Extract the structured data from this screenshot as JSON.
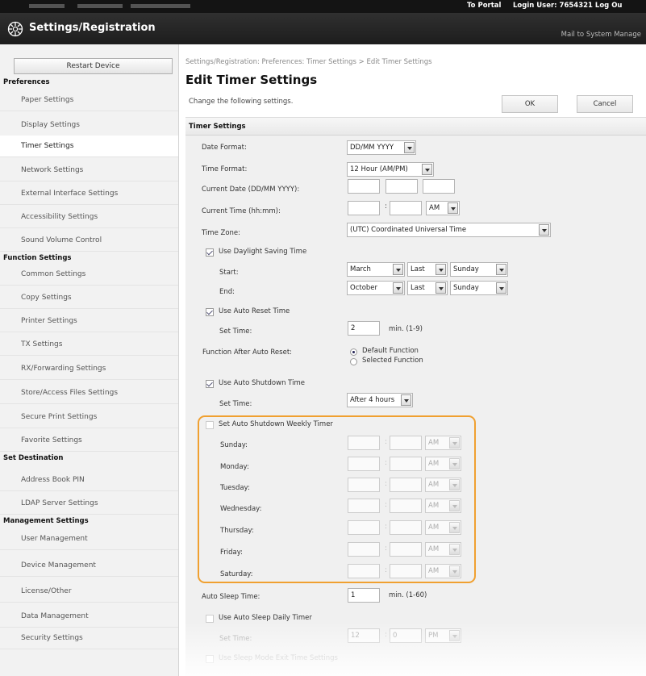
{
  "topbar": {
    "to_portal": "To Portal",
    "login_user": "Login User:  7654321  Log Ou"
  },
  "header": {
    "title": "Settings/Registration",
    "mail": "Mail to System Manage"
  },
  "sidebar": {
    "restart_label": "Restart Device",
    "sections": [
      {
        "title": "Preferences",
        "items": [
          "Paper Settings",
          "Display Settings",
          "Timer Settings",
          "Network Settings",
          "External Interface Settings",
          "Accessibility Settings",
          "Sound Volume Control"
        ]
      },
      {
        "title": "Function Settings",
        "items": [
          "Common Settings",
          "Copy Settings",
          "Printer Settings",
          "TX Settings",
          "RX/Forwarding Settings",
          "Store/Access Files Settings",
          "Secure Print Settings",
          "Favorite Settings"
        ]
      },
      {
        "title": "Set Destination",
        "items": [
          "Address Book PIN",
          "LDAP Server Settings"
        ]
      },
      {
        "title": "Management Settings",
        "items": [
          "User Management",
          "Device Management",
          "License/Other",
          "Data Management",
          "Security Settings"
        ]
      }
    ],
    "active_item": "Timer Settings"
  },
  "main": {
    "breadcrumb": "Settings/Registration: Preferences: Timer Settings > Edit Timer Settings",
    "page_title": "Edit Timer Settings",
    "description": "Change the following settings.",
    "ok_label": "OK",
    "cancel_label": "Cancel",
    "panel_title": "Timer Settings"
  },
  "form": {
    "date_format_label": "Date Format:",
    "date_format_value": "DD/MM YYYY",
    "time_format_label": "Time Format:",
    "time_format_value": "12 Hour (AM/PM)",
    "current_date_label": "Current Date (DD/MM YYYY):",
    "current_time_label": "Current Time (hh:mm):",
    "current_time_ampm": "AM",
    "time_zone_label": "Time Zone:",
    "time_zone_value": "(UTC) Coordinated Universal Time",
    "dst_label": "Use Daylight Saving Time",
    "start_label": "Start:",
    "start_month": "March",
    "start_week": "Last",
    "start_day": "Sunday",
    "end_label": "End:",
    "end_month": "October",
    "end_week": "Last",
    "end_day": "Sunday",
    "auto_reset_label": "Use Auto Reset Time",
    "set_time_label": "Set Time:",
    "auto_reset_value": "2",
    "auto_reset_unit": "min. (1-9)",
    "function_after_label": "Function After Auto Reset:",
    "default_function": "Default Function",
    "selected_function": "Selected Function",
    "auto_shutdown_label": "Use Auto Shutdown Time",
    "auto_shutdown_value": "After 4 hours",
    "weekly_timer_label": "Set Auto Shutdown Weekly Timer",
    "weekdays": [
      "Sunday:",
      "Monday:",
      "Tuesday:",
      "Wednesday:",
      "Thursday:",
      "Friday:",
      "Saturday:"
    ],
    "weekday_ampm": "AM",
    "auto_sleep_label": "Auto Sleep Time:",
    "auto_sleep_value": "1",
    "auto_sleep_unit": "min. (1-60)",
    "sleep_daily_label": "Use Auto Sleep Daily Timer",
    "sleep_hour": "12",
    "sleep_min": "0",
    "sleep_ampm": "PM",
    "sleep_exit_label": "Use Sleep Mode Exit Time Settings"
  },
  "colors": {
    "highlight": "#f0a030",
    "header_bg": "#1d1d1d"
  }
}
